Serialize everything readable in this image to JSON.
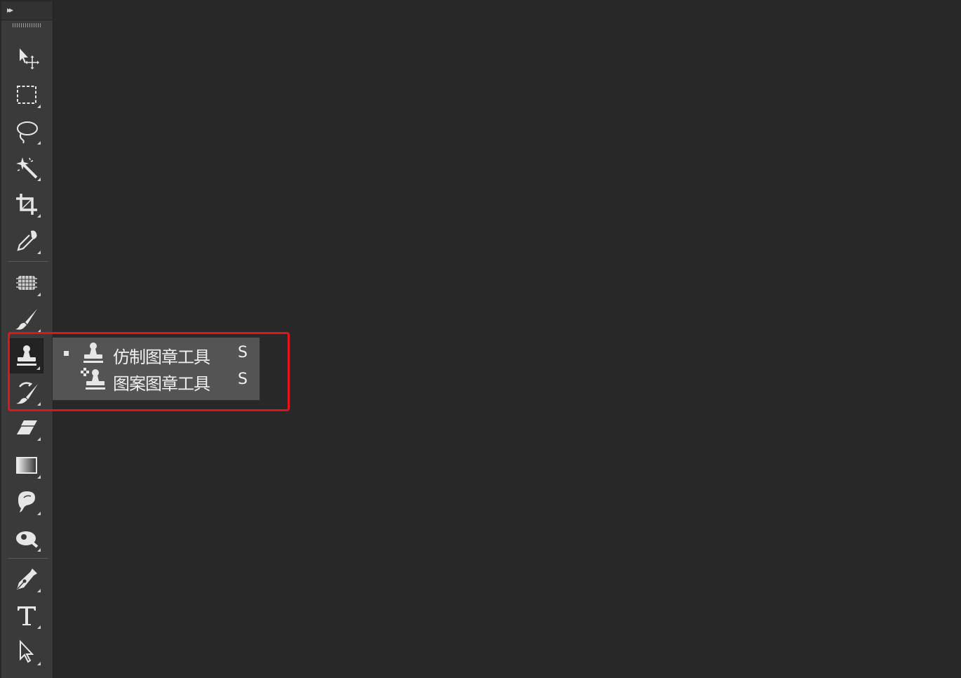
{
  "toolbar": {
    "collapse_glyph": "▸▸",
    "tools": [
      {
        "name": "move-tool",
        "icon": "move-icon"
      },
      {
        "name": "marquee-tool",
        "icon": "rect-marquee-icon"
      },
      {
        "name": "lasso-tool",
        "icon": "lasso-icon"
      },
      {
        "name": "magic-wand-tool",
        "icon": "magic-wand-icon"
      },
      {
        "name": "crop-tool",
        "icon": "crop-icon"
      },
      {
        "name": "eyedropper-tool",
        "icon": "eyedropper-icon"
      },
      {
        "name": "healing-brush-tool",
        "icon": "healing-brush-icon"
      },
      {
        "name": "brush-tool",
        "icon": "brush-icon"
      },
      {
        "name": "clone-stamp-tool",
        "icon": "clone-stamp-icon",
        "active": true
      },
      {
        "name": "history-brush-tool",
        "icon": "history-brush-icon"
      },
      {
        "name": "eraser-tool",
        "icon": "eraser-icon"
      },
      {
        "name": "gradient-tool",
        "icon": "gradient-icon"
      },
      {
        "name": "blur-tool",
        "icon": "blur-icon"
      },
      {
        "name": "dodge-tool",
        "icon": "dodge-icon"
      },
      {
        "name": "pen-tool",
        "icon": "pen-icon"
      },
      {
        "name": "type-tool",
        "icon": "type-icon"
      },
      {
        "name": "path-selection-tool",
        "icon": "path-selection-icon"
      }
    ]
  },
  "flyout": {
    "items": [
      {
        "label": "仿制图章工具",
        "shortcut": "S",
        "selected": true
      },
      {
        "label": "图案图章工具",
        "shortcut": "S",
        "selected": false
      }
    ]
  },
  "colors": {
    "highlight": "#e0151b",
    "canvas": "#282828",
    "panel": "#3a3a3a",
    "flyout": "#545454"
  }
}
